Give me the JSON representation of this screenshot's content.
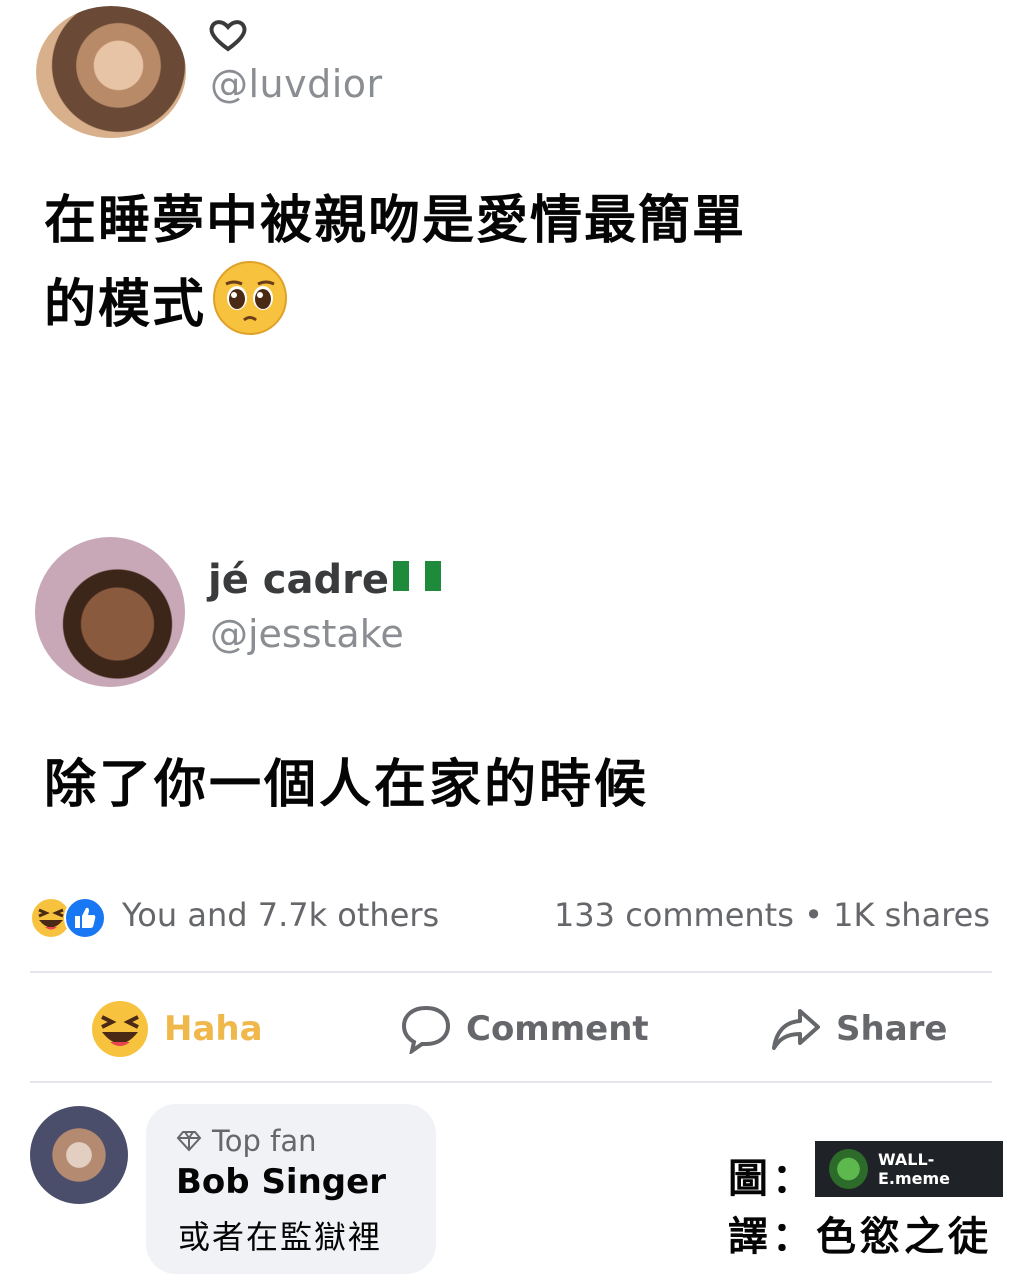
{
  "tweet1": {
    "handle": "@luvdior",
    "text_line1": "在睡夢中被親吻是愛情最簡單",
    "text_line2": "的模式",
    "emoji": "pleading-face-emoji"
  },
  "tweet2": {
    "display_name": "jé cadre",
    "flag": "nigeria-flag",
    "handle": "@jesstake",
    "text": "除了你一個人在家的時候"
  },
  "reactions": {
    "icons": [
      "haha-reaction-icon",
      "like-reaction-icon"
    ],
    "summary": "You and 7.7k others",
    "stats": "133 comments • 1K shares"
  },
  "actions": {
    "haha_label": "Haha",
    "comment_label": "Comment",
    "share_label": "Share"
  },
  "comment": {
    "badge": "Top fan",
    "author": "Bob Singer",
    "text": "或者在監獄裡"
  },
  "credits": {
    "image_label": "圖：",
    "translate_label": "譯：色慾之徒",
    "watermark": "WALL-E.meme"
  },
  "colors": {
    "haha_yellow": "#f0b74a",
    "like_blue": "#1877f2",
    "secondary_text": "#65676b",
    "bubble_bg": "#f0f2f5"
  }
}
